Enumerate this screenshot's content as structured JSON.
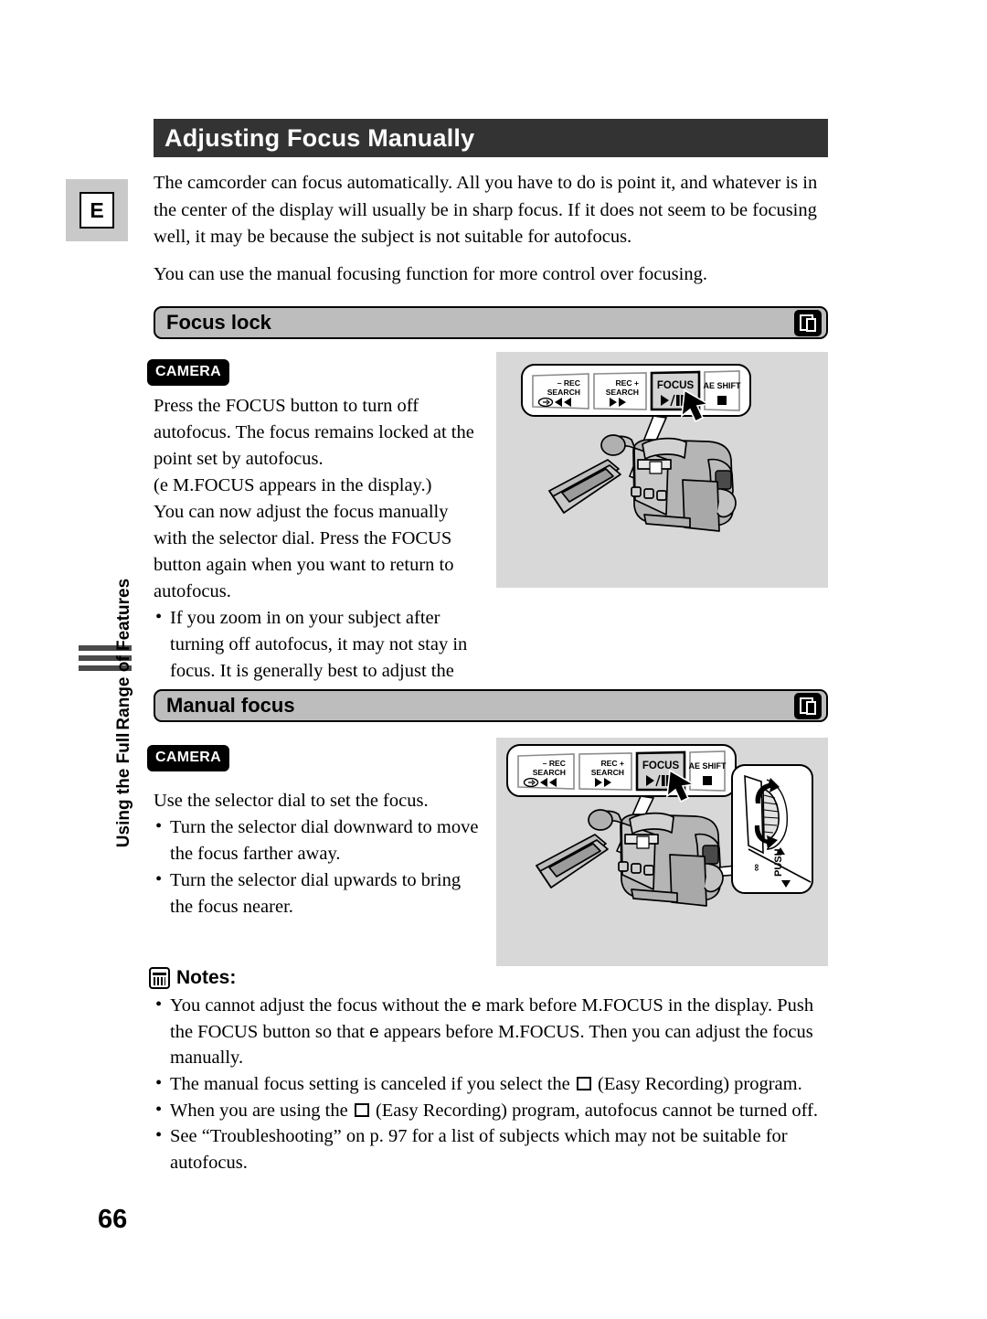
{
  "page": {
    "number": "66",
    "language_badge": "E",
    "title": "Adjusting Focus Manually",
    "side_tab": {
      "line1": "Using the Full",
      "line2": "Range of Features"
    }
  },
  "intro": {
    "paragraph1": "The camcorder can focus automatically. All you have to do is point it, and whatever is in the center of the display will usually be in sharp focus. If it does not seem to be focusing well, it may be because the subject is not suitable for autofocus.",
    "paragraph2": "You can use the manual focusing function for more control over focusing."
  },
  "sections": [
    {
      "heading": "Focus lock",
      "icon": "tape-icon",
      "mode_chip": "CAMERA",
      "body": "Press the FOCUS button to turn off autofocus. The focus remains locked at the point set by autofocus.",
      "body_line_e": "(e M.FOCUS appears in the display.)",
      "body2": "You can now adjust the focus manually with the selector dial. Press the FOCUS button again when you want to return to autofocus.",
      "bullets": [
        "If you zoom in on your subject after turning off autofocus, it may not stay in focus. It is generally best to adjust the zoom first, and then the focus."
      ]
    },
    {
      "heading": "Manual focus",
      "icon": "tape-icon",
      "mode_chip": "CAMERA",
      "body": "Use the selector dial to set the focus.",
      "bullets": [
        "Turn the selector dial downward to move the focus farther away.",
        "Turn the selector dial upwards to bring the focus nearer."
      ]
    }
  ],
  "figure_buttons": [
    {
      "top": "– REC",
      "bottom": "SEARCH",
      "glyph": "rewind"
    },
    {
      "top": "REC +",
      "bottom": "SEARCH",
      "glyph": "fast-forward"
    },
    {
      "top": "FOCUS",
      "bottom": "",
      "glyph": "play-pause"
    },
    {
      "top": "AE SHIFT",
      "bottom": "",
      "glyph": "stop"
    }
  ],
  "dial_inset": {
    "label": "PUSH"
  },
  "notes": {
    "heading": "Notes:",
    "items": [
      {
        "pre": "You cannot adjust the focus without the ",
        "e1": "e",
        "mid": " mark before M.FOCUS in the display. Push the FOCUS button so that ",
        "e2": "e",
        "post": " appears before M.FOCUS. Then you can adjust the focus manually."
      },
      {
        "pre": "The manual focus setting is canceled if you select the ",
        "square": true,
        "post": " (Easy Recording) program."
      },
      {
        "pre": "When you are using the ",
        "square": true,
        "post": " (Easy Recording) program, autofocus cannot be turned off."
      },
      {
        "pre": "See “Troubleshooting” on p. 97 for a list of subjects which may not be suitable for autofocus.",
        "post": ""
      }
    ]
  },
  "colors": {
    "title_bar": "#333333",
    "section_bar": "#bdbdbd",
    "figure_bg": "#d8d8d8",
    "badge_bg": "#c9c9c9"
  }
}
